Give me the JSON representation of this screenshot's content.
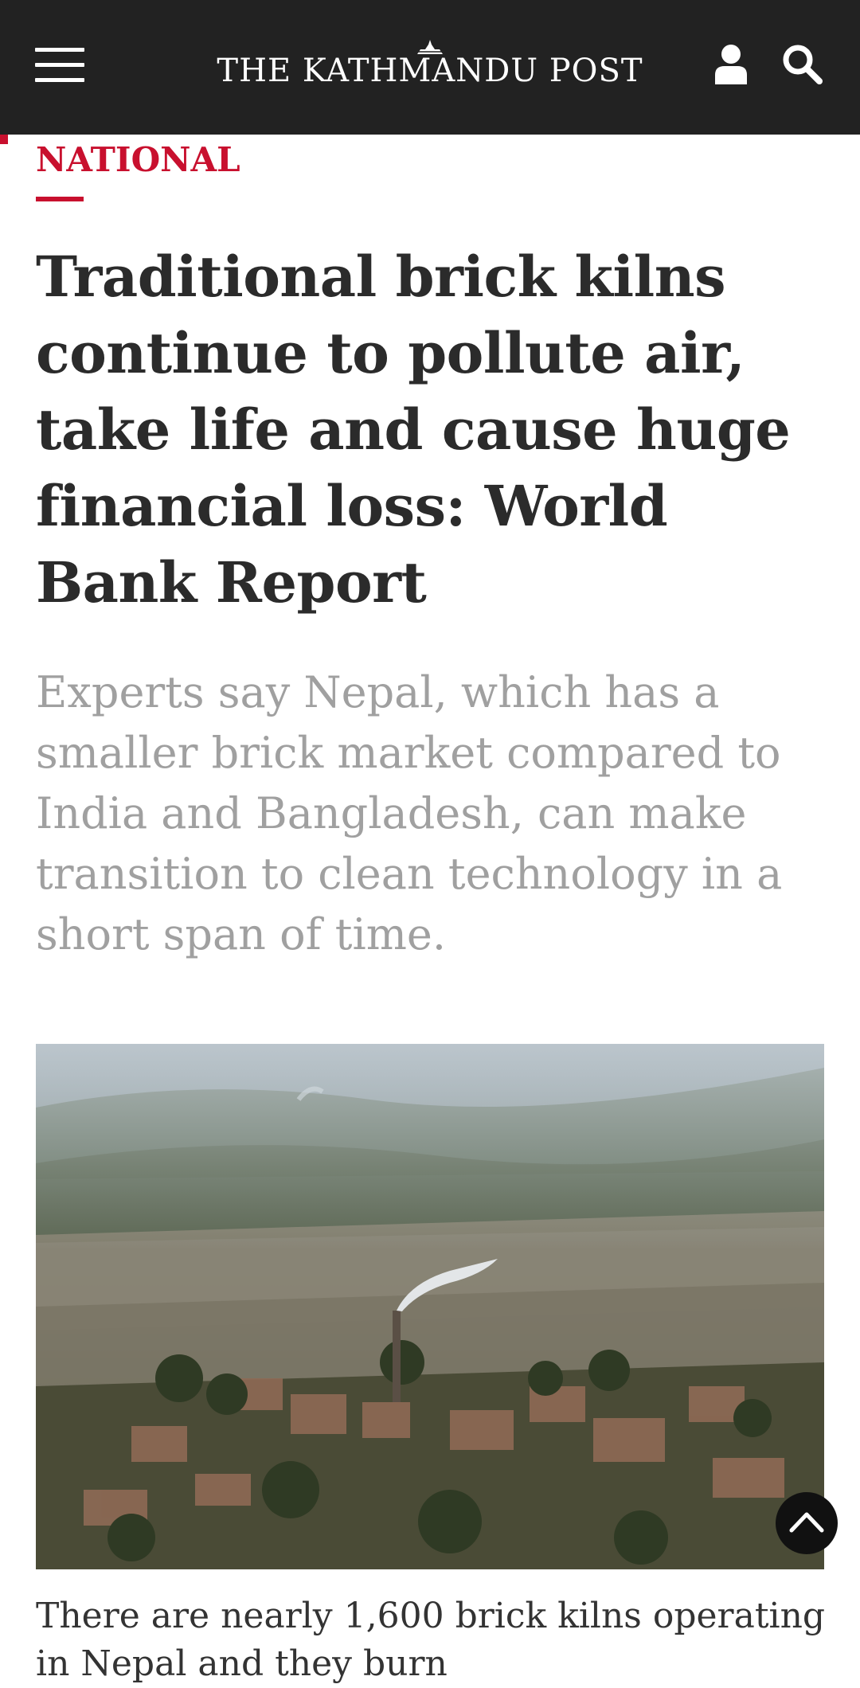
{
  "header": {
    "masthead": "THE KATHMANDU POST",
    "menu_icon": "hamburger-menu-icon",
    "user_icon": "user-icon",
    "search_icon": "search-icon",
    "background_color": "#222222"
  },
  "article": {
    "section": "NATIONAL",
    "section_color": "#c8102e",
    "headline": "Traditional brick kilns continue to pollute air, take life and cause huge financial loss: World Bank Report",
    "subheadline": "Experts say Nepal, which has a smaller brick market compared to India and Bangladesh, can make transition to clean technology in a short span of time.",
    "image_icon": "photo-brick-kiln-landscape",
    "body_start": "There are nearly 1,600 brick kilns operating in Nepal and they burn"
  },
  "controls": {
    "scroll_top_icon": "chevron-up-icon"
  }
}
